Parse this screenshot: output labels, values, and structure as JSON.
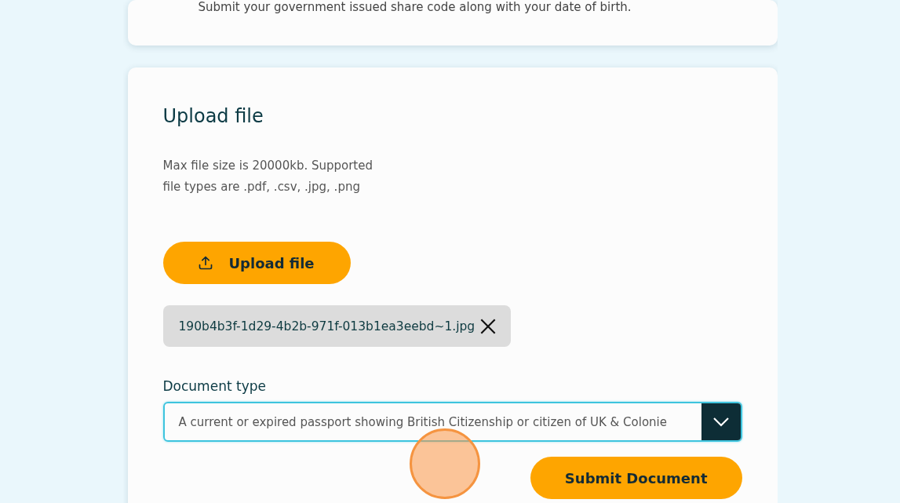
{
  "share_code_card": {
    "text": "Submit your government issued share code along with your date of birth."
  },
  "upload_card": {
    "title": "Upload file",
    "hint_lines": [
      "Max file size is 20000kb. Supported",
      "file types are .pdf, .csv, .jpg, .png"
    ],
    "upload_button": "Upload file",
    "files": [
      {
        "name": "190b4b3f-1d29-4b2b-971f-013b1ea3eebd~1.jpg"
      }
    ],
    "document_type": {
      "label": "Document type",
      "value": "A current or expired passport showing British Citizenship or citizen of UK & Colonie",
      "focused": true
    },
    "submit_button": "Submit Document"
  }
}
